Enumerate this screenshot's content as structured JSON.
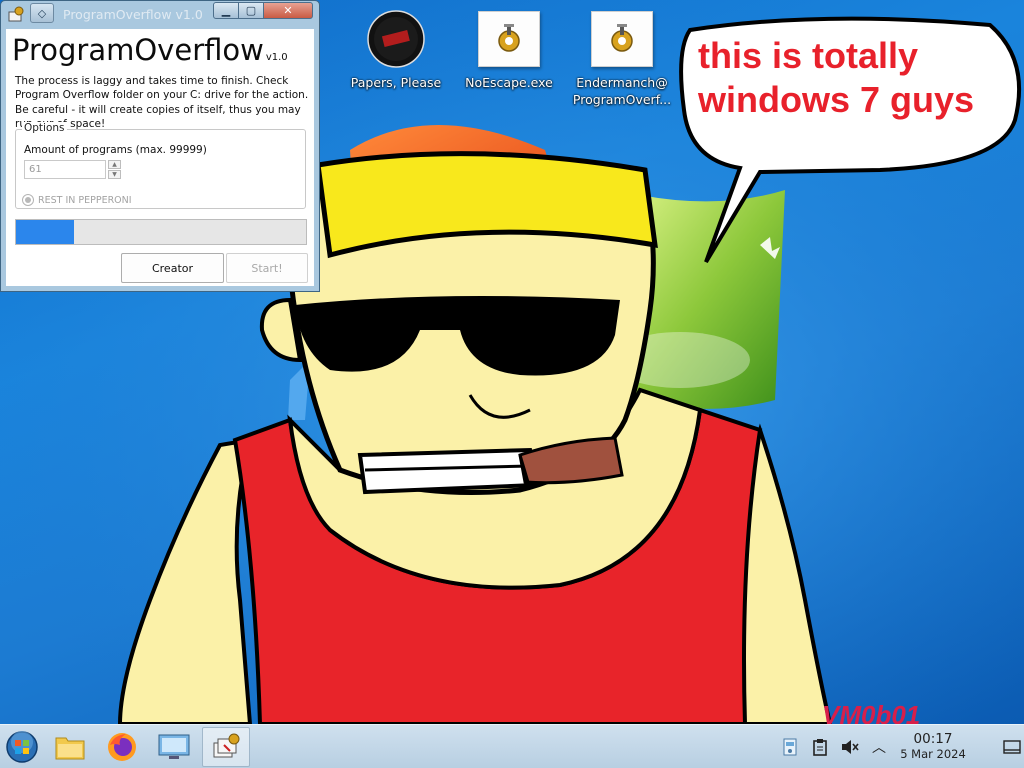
{
  "wallpaper": {
    "speech_bubble_line1": "this is totally",
    "speech_bubble_line2": "windows 7 guys",
    "signature": "VM0b01",
    "colors": {
      "sky": "#1479d4",
      "headband": "#f8e81c",
      "tank_top": "#e8242a",
      "skin": "#fbf1a8",
      "speech_text": "#e8212b"
    }
  },
  "desktop_icons": [
    {
      "label": "Papers, Please",
      "icon": "papers-please-icon"
    },
    {
      "label": "NoEscape.exe",
      "icon": "gear-app-icon"
    },
    {
      "label_line1": "Endermanch@",
      "label_line2": "ProgramOverf...",
      "icon": "gear-app-icon"
    }
  ],
  "app_window": {
    "titlebar_title": "ProgramOverflow v1.0",
    "app_name": "ProgramOverflow",
    "version": "v1.0",
    "description": "The process is laggy and takes time to finish. Check Program Overflow folder on your C: drive for the action. Be careful - it will create copies of itself, thus you may run our of space!",
    "options_title": "Options",
    "amount_label": "Amount of programs (max. 99999)",
    "amount_value": "61",
    "radio_label": "REST IN PEPPERONI",
    "radio_checked": true,
    "progress_fraction": 0.2,
    "progress_color": "#2b86ec",
    "buttons": {
      "creator": "Creator",
      "start": "Start!"
    }
  },
  "taskbar": {
    "items": [
      {
        "name": "start-orb-icon",
        "active": false
      },
      {
        "name": "file-explorer-icon",
        "active": false
      },
      {
        "name": "firefox-icon",
        "active": false
      },
      {
        "name": "remote-desktop-icon",
        "active": false
      },
      {
        "name": "programoverflow-icon",
        "active": true
      }
    ],
    "tray_icons": [
      "network-drive-icon",
      "clipboard-icon",
      "muted-speaker-icon",
      "chevron-up-icon"
    ],
    "time": "00:17",
    "date": "5 Mar 2024"
  }
}
